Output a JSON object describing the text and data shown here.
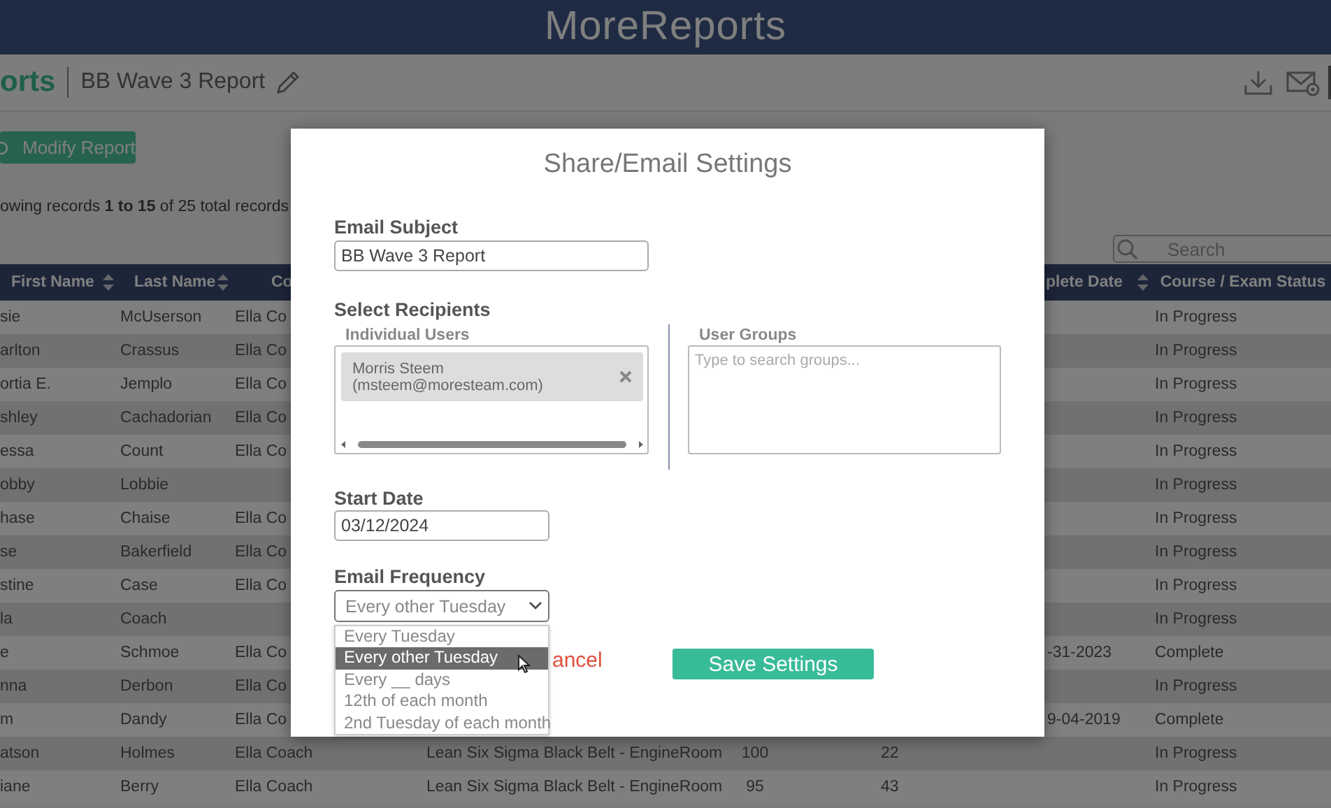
{
  "app": {
    "title": "MoreReports"
  },
  "report_bar": {
    "breadcrumb": "orts",
    "report_name": "BB Wave 3 Report"
  },
  "modify_button": {
    "label": "Modify Report"
  },
  "records_summary": "owing records **1 to 15** of 25 total records",
  "search": {
    "placeholder": "Search"
  },
  "table": {
    "columns": [
      {
        "label": "First Name",
        "sortable": true
      },
      {
        "label": "Last Name",
        "sortable": true
      },
      {
        "label": "Co"
      },
      {
        "label": "plete Date",
        "sortable": true
      },
      {
        "label": "Course / Exam Status",
        "sortable": false
      }
    ],
    "rows": [
      {
        "first_name": "sie",
        "last_name": "McUserson",
        "coach": "Ella Co",
        "status": "In Progress"
      },
      {
        "first_name": "arlton",
        "last_name": "Crassus",
        "coach": "Ella Co",
        "status": "In Progress"
      },
      {
        "first_name": "ortia E.",
        "last_name": "Jemplo",
        "coach": "Ella Co",
        "status": "In Progress"
      },
      {
        "first_name": "shley",
        "last_name": "Cachadorian",
        "coach": "Ella Co",
        "status": "In Progress"
      },
      {
        "first_name": "essa",
        "last_name": "Count",
        "coach": "Ella Co",
        "status": "In Progress"
      },
      {
        "first_name": "obby",
        "last_name": "Lobbie",
        "status": "In Progress"
      },
      {
        "first_name": "hase",
        "last_name": "Chaise",
        "coach": "Ella Co",
        "status": "In Progress"
      },
      {
        "first_name": "se",
        "last_name": "Bakerfield",
        "coach": "Ella Co",
        "status": "In Progress"
      },
      {
        "first_name": "stine",
        "last_name": "Case",
        "coach": "Ella Co",
        "status": "In Progress"
      },
      {
        "first_name": "la",
        "last_name": "Coach",
        "status": "In Progress"
      },
      {
        "first_name": "e",
        "last_name": "Schmoe",
        "coach": "Ella Co",
        "complete_date": "-31-2023",
        "status": "Complete"
      },
      {
        "first_name": "nna",
        "last_name": "Derbon",
        "coach": "Ella Co",
        "status": "In Progress"
      },
      {
        "first_name": "m",
        "last_name": "Dandy",
        "coach": "Ella Co",
        "complete_date": "9-04-2019",
        "status": "Complete"
      },
      {
        "first_name": "atson",
        "last_name": "Holmes",
        "coach": "Ella Coach",
        "course": "Lean Six Sigma Black Belt - EngineRoom",
        "score": "100",
        "column_6": "22",
        "status": "In Progress"
      },
      {
        "first_name": "iane",
        "last_name": "Berry",
        "coach": "Ella Coach",
        "course": "Lean Six Sigma Black Belt - EngineRoom",
        "score": "95",
        "column_6": "43",
        "status": "In Progress"
      }
    ]
  },
  "modal": {
    "title": "Share/Email Settings",
    "email_subject": {
      "label": "Email Subject",
      "value": "BB Wave 3 Report"
    },
    "recipients": {
      "label": "Select Recipients",
      "individual_users": {
        "label": "Individual Users",
        "selected_users": [
          "Morris Steem (msteem@moresteam.com)"
        ]
      },
      "user_groups": {
        "label": "User Groups",
        "placeholder": "Type to search groups..."
      }
    },
    "start_date": {
      "label": "Start Date",
      "value": "03/12/2024"
    },
    "email_frequency": {
      "label": "Email Frequency",
      "value": "Every other Tuesday",
      "expanded": true,
      "options": [
        {
          "label": "Every Tuesday",
          "selected": false
        },
        {
          "label": "Every other Tuesday",
          "selected": true
        },
        {
          "label": "Every __ days",
          "selected": false
        },
        {
          "label": "12th of each month",
          "selected": false
        },
        {
          "label": "2nd Tuesday of each month",
          "selected": false
        }
      ]
    },
    "cancel_button": "ancel",
    "save_button": "Save Settings"
  }
}
